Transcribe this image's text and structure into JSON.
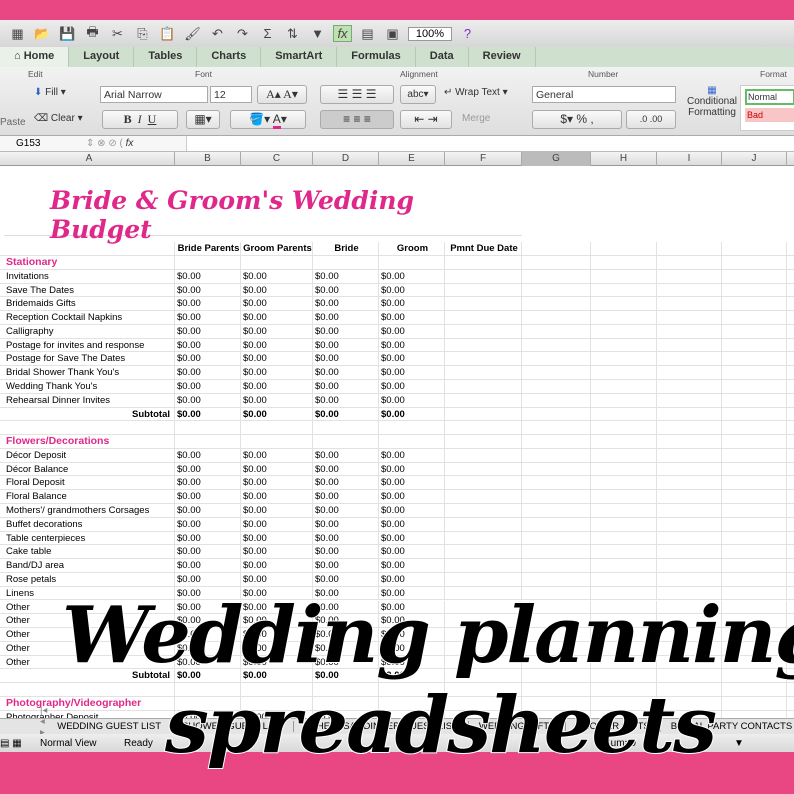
{
  "toolbar": {
    "zoom": "100%"
  },
  "tabs": [
    "Home",
    "Layout",
    "Tables",
    "Charts",
    "SmartArt",
    "Formulas",
    "Data",
    "Review"
  ],
  "ribbon": {
    "edit": "Edit",
    "font": "Font",
    "alignment": "Alignment",
    "number": "Number",
    "format": "Format",
    "paste": "Paste",
    "fill": "Fill",
    "clear": "Clear",
    "font_name": "Arial Narrow",
    "font_size": "12",
    "wrap": "Wrap Text",
    "merge": "Merge",
    "number_format": "General",
    "conditional": "Conditional Formatting",
    "normal": "Normal",
    "bad": "Bad"
  },
  "formula": {
    "cell": "G153",
    "fx": "fx"
  },
  "columns": [
    "A",
    "B",
    "C",
    "D",
    "E",
    "F",
    "G",
    "H",
    "I",
    "J"
  ],
  "title": "Bride & Groom's Wedding Budget",
  "headers": [
    "",
    "Bride Parents",
    "Groom Parents",
    "Bride",
    "Groom",
    "Pmnt Due Date"
  ],
  "rows": [
    {
      "s": "Stationary"
    },
    {
      "a": "Invitations",
      "v": 4
    },
    {
      "a": "Save The Dates",
      "v": 4
    },
    {
      "a": "Bridemaids Gifts",
      "v": 4
    },
    {
      "a": "Reception Cocktail Napkins",
      "v": 4
    },
    {
      "a": "Calligraphy",
      "v": 4
    },
    {
      "a": "Postage for invites and response",
      "v": 4
    },
    {
      "a": "Postage for Save The Dates",
      "v": 4
    },
    {
      "a": "Bridal Shower Thank You's",
      "v": 4
    },
    {
      "a": "Wedding Thank You's",
      "v": 4
    },
    {
      "a": "Rehearsal Dinner Invites",
      "v": 4
    },
    {
      "t": "Subtotal"
    },
    {
      "a": ""
    },
    {
      "s": "Flowers/Decorations"
    },
    {
      "a": "Décor Deposit",
      "v": 4
    },
    {
      "a": "Décor Balance",
      "v": 4
    },
    {
      "a": "Floral Deposit",
      "v": 4
    },
    {
      "a": "Floral Balance",
      "v": 4
    },
    {
      "a": "Mothers'/ grandmothers Corsages",
      "v": 4
    },
    {
      "a": "Buffet decorations",
      "v": 4
    },
    {
      "a": "Table centerpieces",
      "v": 4
    },
    {
      "a": "Cake table",
      "v": 4
    },
    {
      "a": "Band/DJ area",
      "v": 4
    },
    {
      "a": "Rose petals",
      "v": 4
    },
    {
      "a": "Linens",
      "v": 4
    },
    {
      "a": "Other",
      "v": 4
    },
    {
      "a": "Other",
      "v": 4
    },
    {
      "a": "Other",
      "v": 4
    },
    {
      "a": "Other",
      "v": 4
    },
    {
      "a": "Other",
      "v": 4
    },
    {
      "t": "Subtotal"
    },
    {
      "a": ""
    },
    {
      "s": "Photography/Videographer"
    },
    {
      "a": "Photographer Deposit",
      "v": 3
    }
  ],
  "zero": "$0.00",
  "sheet_tabs": [
    "WEDDING GUEST LIST",
    "SHOWER GUEST LIST",
    "REHEARSAL DINNER GUEST LIST",
    "WEDDING GIFTS",
    "SHOWER GIFTS",
    "BRIDAL PARTY CONTACTS"
  ],
  "status": {
    "view": "Normal View",
    "ready": "Ready",
    "sum": "Sum=0"
  },
  "overlay": {
    "line1": "Wedding planning",
    "line2": "spreadsheets"
  },
  "colors": {
    "border": "#e94784",
    "accent": "#e0288a"
  }
}
